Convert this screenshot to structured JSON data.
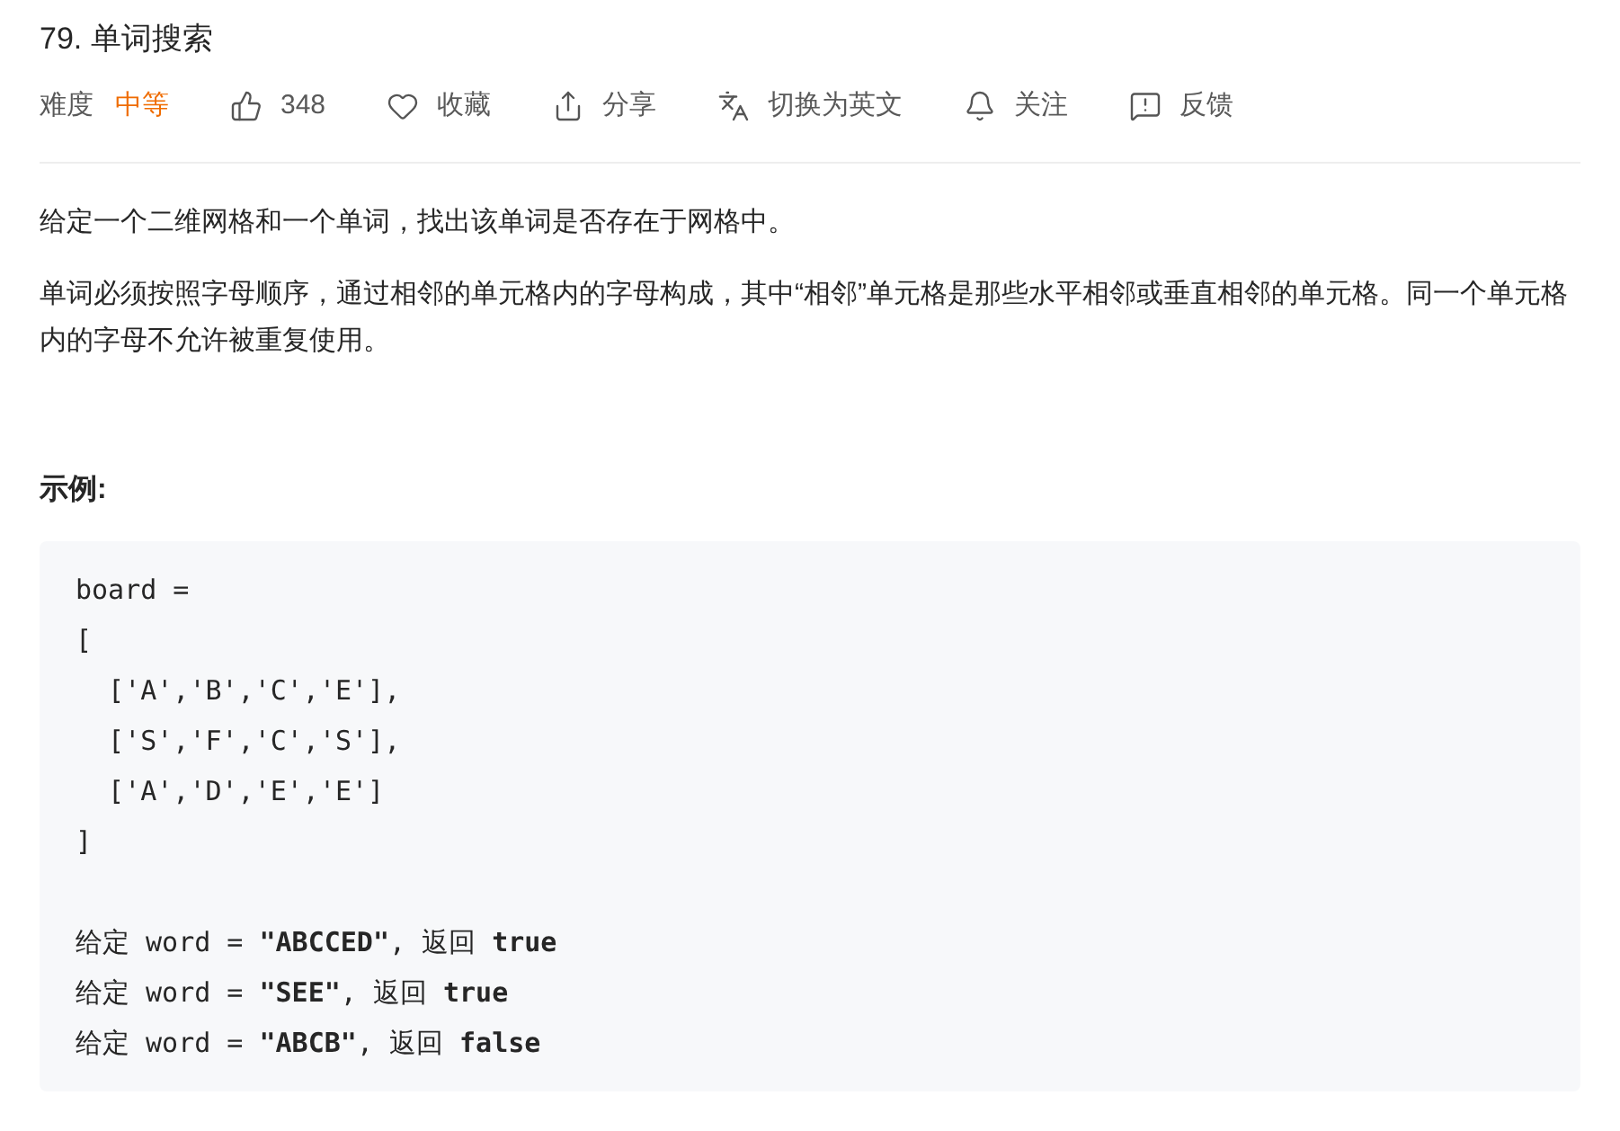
{
  "title": "79. 单词搜索",
  "difficulty": {
    "label": "难度",
    "value": "中等"
  },
  "actions": [
    {
      "kind": "like",
      "label": "348"
    },
    {
      "kind": "favorite",
      "label": "收藏"
    },
    {
      "kind": "share",
      "label": "分享"
    },
    {
      "kind": "translate",
      "label": "切换为英文"
    },
    {
      "kind": "follow",
      "label": "关注"
    },
    {
      "kind": "feedback",
      "label": "反馈"
    }
  ],
  "paragraphs": [
    "给定一个二维网格和一个单词，找出该单词是否存在于网格中。",
    "单词必须按照字母顺序，通过相邻的单元格内的字母构成，其中“相邻”单元格是那些水平相邻或垂直相邻的单元格。同一个单元格内的字母不允许被重复使用。"
  ],
  "example_heading": "示例:",
  "code": {
    "board_lines": [
      "board =",
      "[",
      "  ['A','B','C','E'],",
      "  ['S','F','C','S'],",
      "  ['A','D','E','E']",
      "]"
    ],
    "result_lines": [
      "给定 word = **\"ABCCED\"**, 返回 **true**",
      "给定 word = **\"SEE\"**, 返回 **true**",
      "给定 word = **\"ABCB\"**, 返回 **false**"
    ]
  }
}
